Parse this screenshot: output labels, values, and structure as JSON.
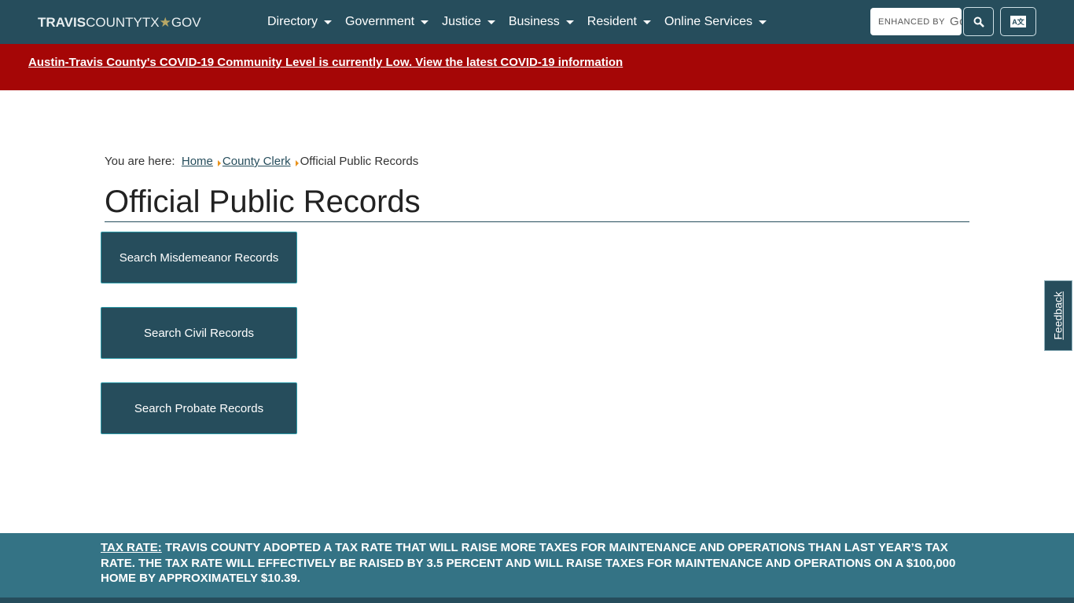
{
  "header": {
    "logo": {
      "bold": "TRAVIS",
      "rest": "COUNTYTX",
      "star": "★",
      "suffix": "GOV"
    },
    "menu": [
      {
        "label": "Directory"
      },
      {
        "label": "Government"
      },
      {
        "label": "Justice"
      },
      {
        "label": "Business"
      },
      {
        "label": "Resident"
      },
      {
        "label": "Online Services"
      }
    ],
    "search_placeholder": "ENHANCED BY",
    "search_brand": "Gc",
    "translate_label": "A文"
  },
  "alert": {
    "text": "Austin-Travis County's COVID-19 Community Level is currently Low. View the latest COVID-19 information"
  },
  "breadcrumb": {
    "prefix": "You are here:",
    "items": [
      "Home",
      "County Clerk"
    ],
    "current": "Official Public Records"
  },
  "page": {
    "title": "Official Public Records",
    "buttons": [
      "Search Misdemeanor Records",
      "Search Civil Records",
      "Search Probate Records"
    ]
  },
  "feedback": "Feedback",
  "tax": {
    "label": "TAX RATE:",
    "text": " TRAVIS COUNTY ADOPTED A TAX RATE THAT WILL RAISE MORE TAXES FOR MAINTENANCE AND OPERATIONS THAN LAST YEAR’S TAX RATE. THE TAX RATE WILL EFFECTIVELY BE RAISED BY 3.5 PERCENT AND WILL RAISE TAXES FOR MAINTENANCE AND OPERATIONS ON A $100,000 HOME BY APPROXIMATELY $10.39."
  }
}
